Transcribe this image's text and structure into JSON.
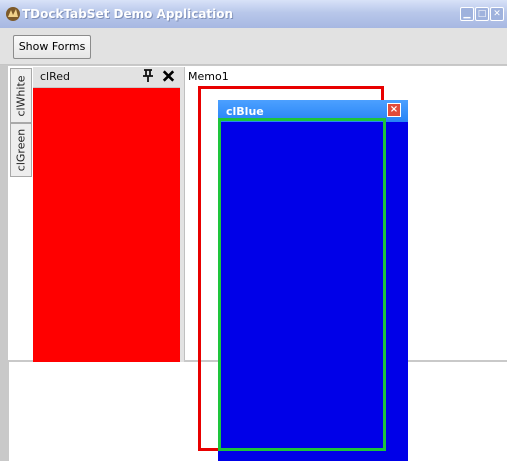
{
  "window": {
    "title": "TDockTabSet Demo Application",
    "caption_buttons": [
      "minimize-icon",
      "maximize-icon",
      "close-icon"
    ]
  },
  "toolbar": {
    "show_forms_label": "Show Forms"
  },
  "tabs": [
    {
      "label": "clWhite"
    },
    {
      "label": "clGreen"
    }
  ],
  "docked_form": {
    "caption": "clRed",
    "color": "#ff0000"
  },
  "memo": {
    "text": "Memo1"
  },
  "floating_form": {
    "title": "clBlue",
    "color": "#0000e8"
  },
  "icons": {
    "app": "app-icon",
    "pin": "pin-icon",
    "dock_close": "close-icon",
    "float_close": "close-icon"
  }
}
